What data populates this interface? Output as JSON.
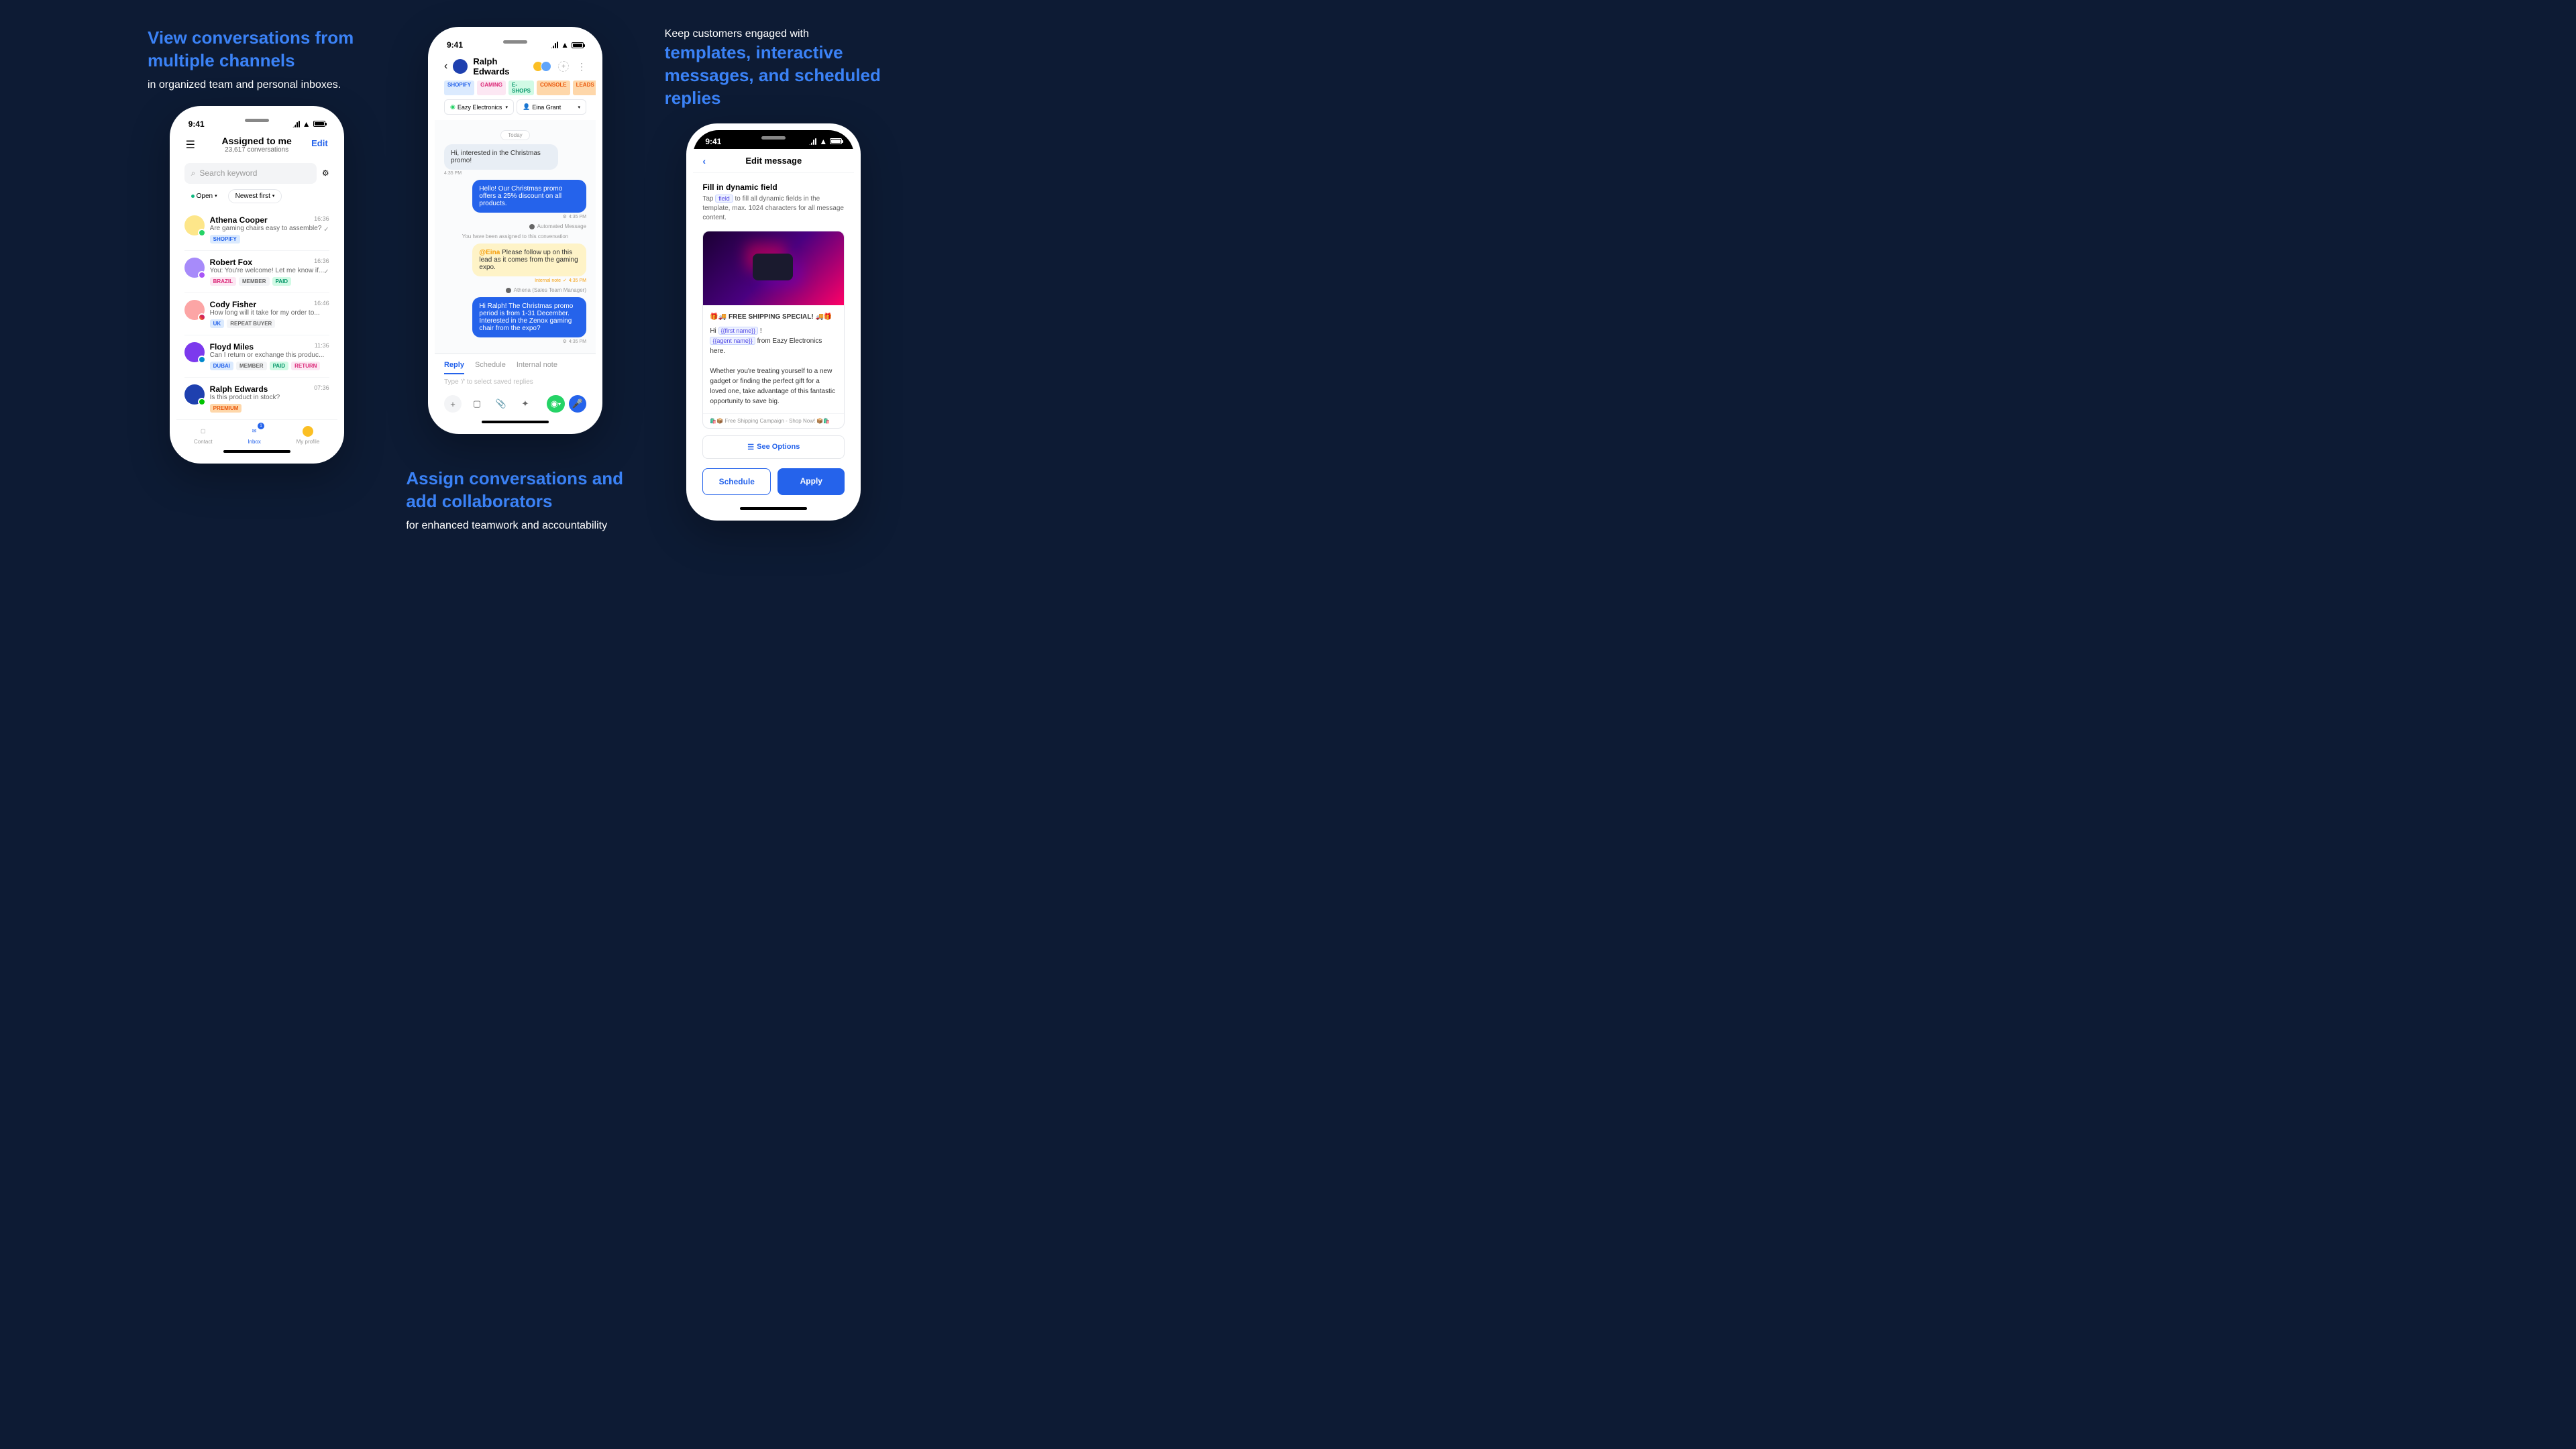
{
  "col1": {
    "heading": "View conversations from multiple channels",
    "sub": "in organized team and personal inboxes."
  },
  "col2": {
    "heading": "Assign conversations and add collaborators",
    "sub": "for enhanced teamwork and accountability"
  },
  "col3": {
    "heading_white": "Keep customers engaged with",
    "heading_blue": "templates, interactive messages, and scheduled replies"
  },
  "status": {
    "time": "9:41"
  },
  "phone1": {
    "title": "Assigned to me",
    "subtitle": "23,617 conversations",
    "edit": "Edit",
    "search_placeholder": "Search keyword",
    "filter_open": "Open",
    "filter_newest": "Newest first",
    "conversations": [
      {
        "name": "Athena Cooper",
        "preview": "Are gaming chairs easy to assemble?",
        "time": "16:36",
        "tags": [
          "SHOPIFY"
        ],
        "check": true
      },
      {
        "name": "Robert Fox",
        "preview": "You: You're welcome! Let me know if...",
        "time": "16:36",
        "tags": [
          "BRAZIL",
          "MEMBER",
          "PAID"
        ],
        "check": true
      },
      {
        "name": "Cody Fisher",
        "preview": "How long will it take for my order to...",
        "time": "16:46",
        "tags": [
          "UK",
          "REPEAT BUYER"
        ]
      },
      {
        "name": "Floyd Miles",
        "preview": "Can I return or exchange this produc...",
        "time": "11:36",
        "tags": [
          "DUBAI",
          "MEMBER",
          "PAID",
          "RETURN"
        ]
      },
      {
        "name": "Ralph Edwards",
        "preview": "Is this product in stock?",
        "time": "07:36",
        "tags": [
          "PREMIUM"
        ]
      }
    ],
    "nav": {
      "contact": "Contact",
      "inbox": "Inbox",
      "profile": "My profile",
      "badge": "1"
    }
  },
  "phone2": {
    "name": "Ralph Edwards",
    "tags": [
      "SHOPIFY",
      "GAMING",
      "E-SHOPS",
      "CONSOLE",
      "LEADS"
    ],
    "selector_company": "Eazy Electronics",
    "selector_assignee": "Eina Grant",
    "date": "Today",
    "msg1": "Hi, interested in the Christmas promo!",
    "msg1_time": "4:35 PM",
    "msg2": "Hello! Our Christmas promo offers a 25% discount on all products.",
    "msg2_time": "4:35 PM",
    "auto": "Automated Message",
    "sys": "You have been assigned to this conversation",
    "note_mention": "@Eina",
    "note_text": " Please follow up on this lead as it comes from the gaming expo.",
    "note_label": "Internal note",
    "note_time": "4:35 PM",
    "note_by": "Athena (Sales Team Manager)",
    "msg3": "Hi Ralph! The Christmas promo period is from 1-31 December. Interested in the Zenox gaming chair from the expo?",
    "msg3_time": "4:35 PM",
    "tabs": {
      "reply": "Reply",
      "schedule": "Schedule",
      "note": "Internal note"
    },
    "input_placeholder": "Type '/' to select saved replies"
  },
  "phone3": {
    "title": "Edit message",
    "section": "Fill in dynamic field",
    "desc_pre": "Tap ",
    "desc_field": "field",
    "desc_post": " to fill all dynamic fields in the template, max. 1024 characters for all message content.",
    "card_title": "🎁🚚 FREE SHIPPING SPECIAL! 🚚🎁",
    "line1_pre": "Hi ",
    "line1_field": "{{first name}}",
    "line1_post": " !",
    "line2_field": "{{agent name}}",
    "line2_post": " from Eazy Electronics here.",
    "card_body": "Whether you're treating yourself to a new gadget or finding the perfect gift for a loved one, take advantage of this fantastic opportunity to save big.",
    "card_footer": "🛍️📦 Free Shipping Campaign - Shop Now! 📦🛍️",
    "options": "See Options",
    "btn_schedule": "Schedule",
    "btn_apply": "Apply"
  }
}
